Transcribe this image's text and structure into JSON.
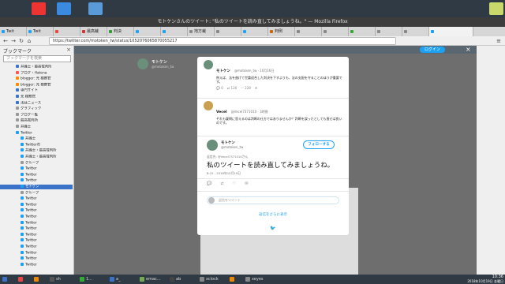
{
  "window": {
    "title": "モトケンさんのツイート: \"私のツイートを読み直してみましょうね。\" — Mozilla Firefox"
  },
  "tabs": [
    {
      "label": "Twit",
      "color": "#1da1f2"
    },
    {
      "label": "Twit",
      "color": "#1da1f2"
    },
    {
      "label": "",
      "color": "#e44"
    },
    {
      "label": "最高裁",
      "color": "#c33"
    },
    {
      "label": "判決",
      "color": "#393"
    },
    {
      "label": "",
      "color": "#1da1f2"
    },
    {
      "label": "",
      "color": "#1da1f2"
    },
    {
      "label": "地方裁",
      "color": "#888"
    },
    {
      "label": "",
      "color": "#888"
    },
    {
      "label": "",
      "color": "#1da1f2"
    },
    {
      "label": "判例",
      "color": "#c60"
    },
    {
      "label": "",
      "color": "#888"
    },
    {
      "label": "",
      "color": "#888"
    },
    {
      "label": "",
      "color": "#3a3"
    },
    {
      "label": "",
      "color": "#888"
    },
    {
      "label": "",
      "color": "#888"
    },
    {
      "label": "",
      "color": "#1da1f2"
    }
  ],
  "navbar": {
    "url": "https://twitter.com/motoken_tw/status/1052076065870055217"
  },
  "sidebar": {
    "title": "ブックマーク",
    "search_placeholder": "ブックマークを検索",
    "items": [
      {
        "label": "弁護士・最高裁判所",
        "color": "#3a73c8"
      },
      {
        "label": "ブログ・Hatena",
        "color": "#f55"
      },
      {
        "label": "blogger: 元 検察官",
        "color": "#f80"
      },
      {
        "label": "blogger: 元 検察官",
        "color": "#f80"
      },
      {
        "label": "専門サイト",
        "color": "#3a73c8"
      },
      {
        "label": "元 検察官",
        "color": "#3a73c8"
      },
      {
        "label": "法廷ニュース",
        "color": "#3a73c8"
      },
      {
        "label": "グラフィック",
        "color": "#999"
      },
      {
        "label": "ブログ一覧",
        "color": "#999"
      },
      {
        "label": "最高裁判所",
        "color": "#999"
      },
      {
        "label": "弁護士",
        "color": "#999"
      },
      {
        "label": "Twitter",
        "color": "#1da1f2"
      },
      {
        "label": "弁護士",
        "color": "#1da1f2"
      },
      {
        "label": "Twitterの",
        "color": "#1da1f2"
      },
      {
        "label": "弁護士・最高裁判所",
        "color": "#1da1f2"
      },
      {
        "label": "弁護士・最高裁判所",
        "color": "#1da1f2"
      },
      {
        "label": "グループ",
        "color": "#999"
      },
      {
        "label": "Twitter",
        "color": "#1da1f2"
      },
      {
        "label": "Twitter",
        "color": "#1da1f2"
      },
      {
        "label": "Twitter",
        "color": "#1da1f2"
      },
      {
        "label": "モトケン",
        "color": "#1da1f2"
      },
      {
        "label": "グループ",
        "color": "#999"
      },
      {
        "label": "Twitter",
        "color": "#1da1f2"
      },
      {
        "label": "Twitter",
        "color": "#1da1f2"
      },
      {
        "label": "Twitter",
        "color": "#1da1f2"
      },
      {
        "label": "Twitter",
        "color": "#1da1f2"
      },
      {
        "label": "Twitter",
        "color": "#1da1f2"
      },
      {
        "label": "Twitter",
        "color": "#1da1f2"
      },
      {
        "label": "Twitter",
        "color": "#1da1f2"
      },
      {
        "label": "Twitter",
        "color": "#1da1f2"
      },
      {
        "label": "Twitter",
        "color": "#1da1f2"
      },
      {
        "label": "Twitter",
        "color": "#1da1f2"
      },
      {
        "label": "Twitter",
        "color": "#1da1f2"
      },
      {
        "label": "Twitter",
        "color": "#1da1f2"
      }
    ]
  },
  "page": {
    "login_label": "ログイン",
    "profile_name": "モトケン",
    "profile_handle": "@motoken_tw"
  },
  "modal": {
    "tweet1": {
      "name": "モトケン",
      "handle": "@motoken_tw · 10月16日",
      "text": "例えば、法を曲げて世論迎合した判決を下すよりも、法の支配を守ることのほうが重要です。",
      "replies": "6",
      "retweets": "126",
      "likes": "228"
    },
    "tweet2": {
      "name": "Vecel",
      "handle": "@Vecel7371010 · 1時間",
      "text": "それも疑問に思えるのは判断の仕方ではありませんか？判断を誤ったとしても直せば良いのです。"
    },
    "main": {
      "name": "モトケン",
      "handle": "@motoken_tw",
      "follow_label": "フォローする",
      "reply_to": "返信先: @Vecel7371010さん",
      "text": "私のツイートを読み直してみましょうね。",
      "time": "8:15 - 2018年10月19日",
      "reply_placeholder": "返信をツイート",
      "more_label": "返信をさらに表示"
    }
  },
  "taskbar": {
    "tasks": [
      {
        "label": "",
        "color": "#3a73c8"
      },
      {
        "label": "",
        "color": "#e44"
      },
      {
        "label": "",
        "color": "#e80"
      },
      {
        "label": "sh",
        "color": "#555"
      },
      {
        "label": "1...",
        "color": "#3a3"
      },
      {
        "label": "a_",
        "color": "#3a73c8"
      },
      {
        "label": "emac...",
        "color": "#7a5"
      },
      {
        "label": "ab",
        "color": "#444"
      },
      {
        "label": "xclock",
        "color": "#888"
      },
      {
        "label": "",
        "color": "#e80"
      },
      {
        "label": "xeyes",
        "color": "#888"
      }
    ],
    "time": "10:36",
    "date": "2018年10月19日 金曜日"
  }
}
